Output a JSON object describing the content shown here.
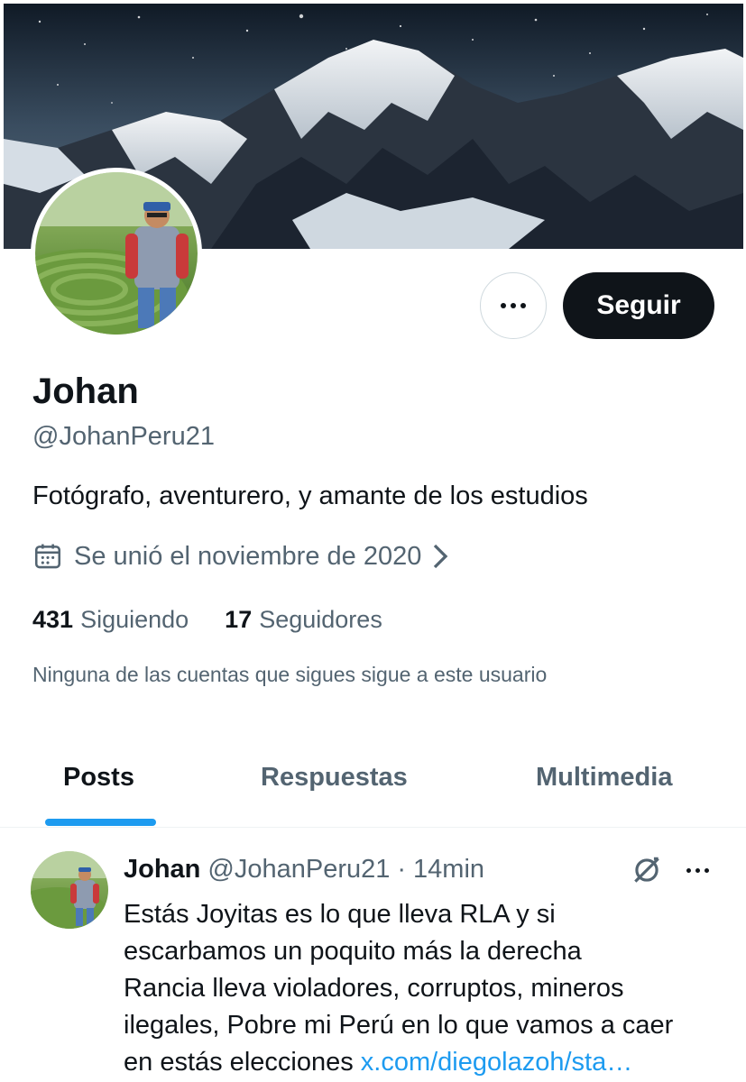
{
  "profile": {
    "name": "Johan",
    "handle": "@JohanPeru21",
    "bio": "Fotógrafo, aventurero, y amante de los estudios",
    "joined": "Se unió el noviembre de 2020",
    "following_count": "431",
    "following_label": "Siguiendo",
    "followers_count": "17",
    "followers_label": "Seguidores",
    "mutual_note": "Ninguna de las cuentas que sigues sigue a este usuario"
  },
  "actions": {
    "follow_label": "Seguir"
  },
  "tabs": [
    {
      "label": "Posts",
      "active": true
    },
    {
      "label": "Respuestas",
      "active": false
    },
    {
      "label": "Multimedia",
      "active": false
    }
  ],
  "post": {
    "author_name": "Johan",
    "author_handle": "@JohanPeru21",
    "separator": "·",
    "time": "14min",
    "text_lines": [
      "Estás Joyitas es lo que lleva RLA y si",
      "escarbamos un poquito más la derecha",
      "Rancia lleva violadores, corruptos, mineros",
      "ilegales, Pobre mi Perú en lo que vamos a caer",
      "en estás elecciones "
    ],
    "link": "x.com/diegolazoh/sta…"
  },
  "icons": {
    "more": "more-horizontal-icon",
    "calendar": "calendar-icon",
    "chevron": "chevron-right-icon",
    "grok": "grok-icon"
  },
  "colors": {
    "accent": "#1d9bf0",
    "text_primary": "#0f1419",
    "text_secondary": "#536471",
    "button_dark": "#0f1419"
  }
}
